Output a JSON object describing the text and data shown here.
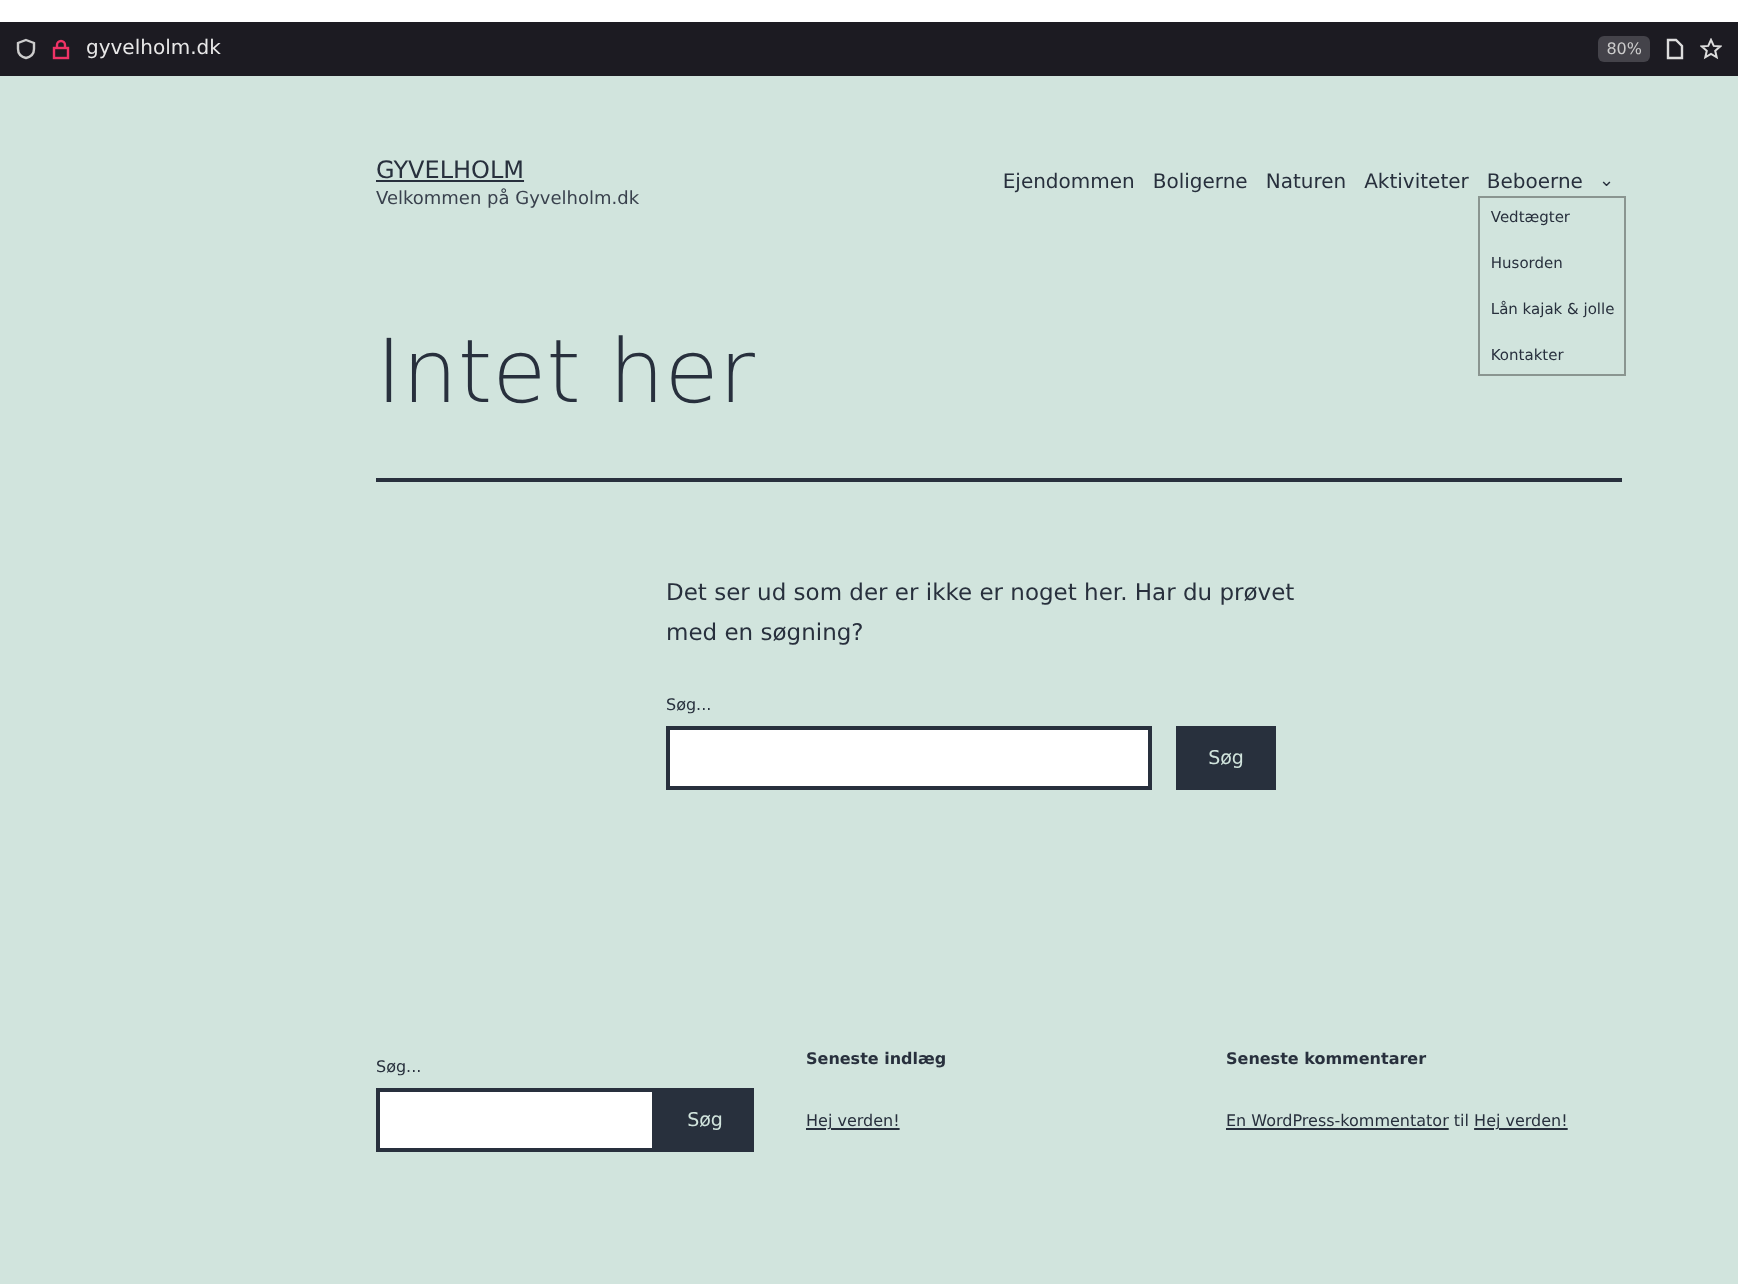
{
  "browser": {
    "url": "gyvelholm.dk",
    "zoom": "80%"
  },
  "site": {
    "title": "GYVELHOLM",
    "tagline": "Velkommen på Gyvelholm.dk"
  },
  "nav": [
    {
      "label": "Ejendommen"
    },
    {
      "label": "Boligerne"
    },
    {
      "label": "Naturen"
    },
    {
      "label": "Aktiviteter"
    },
    {
      "label": "Beboerne",
      "expanded": true,
      "toggle": "⌄",
      "children": [
        {
          "label": "Vedtægter"
        },
        {
          "label": "Husorden"
        },
        {
          "label": "Lån kajak & jolle"
        },
        {
          "label": "Kontakter"
        }
      ]
    }
  ],
  "heading": "Intet her",
  "message": "Det ser ud som der er ikke er noget her. Har du prøvet med en søgning?",
  "search": {
    "label": "Søg...",
    "button": "Søg"
  },
  "footer": {
    "search": {
      "label": "Søg...",
      "button": "Søg"
    },
    "recent_posts": {
      "title": "Seneste indlæg",
      "items": [
        "Hej verden!"
      ]
    },
    "recent_comments": {
      "title": "Seneste kommentarer",
      "items": [
        {
          "author": "En WordPress-kommentator",
          "joiner": "til",
          "post": "Hej verden!"
        }
      ]
    }
  }
}
